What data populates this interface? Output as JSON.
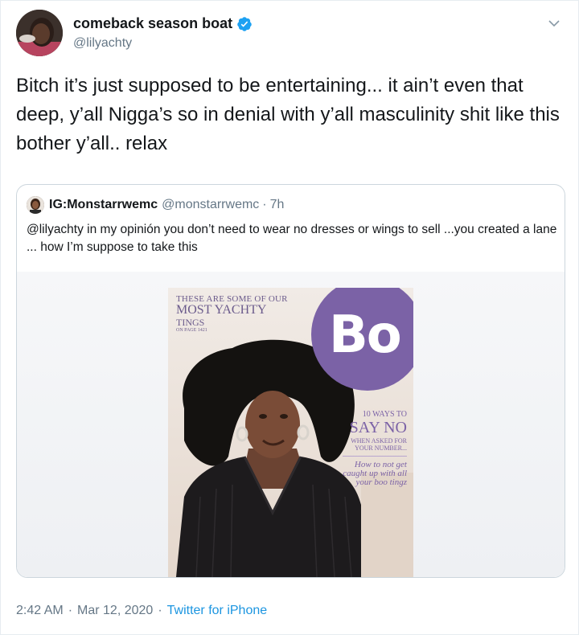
{
  "author": {
    "display_name": "comeback season boat",
    "handle": "@lilyachty",
    "verified": true,
    "avatar_icon": "avatar-photo"
  },
  "tweet": {
    "text": "Bitch it’s just supposed to be entertaining... it ain’t even that deep, y’all Nigga’s so in denial with y’all masculinity shit like this bother y’all.. relax"
  },
  "quoted": {
    "display_name": "IG:Monstarrwemc",
    "handle": "@monstarrwemc",
    "separator": "·",
    "time": "7h",
    "text": "@lilyachty in my opinión you don’t need to wear no dresses or wings to sell ...you created a lane ... how I’m suppose to take this",
    "media": {
      "kicker": "THESE ARE SOME OF OUR",
      "headline": "MOST YACHTY",
      "headline2": "TINGS",
      "page_ref": "ON PAGE 1421",
      "logo": "Bo",
      "side_top": "10 WAYS TO",
      "side_big": "SAY NO",
      "side_small": "WHEN ASKED FOR YOUR NUMBER...",
      "side_italic": "How to not get caught up with all your boo tingz"
    }
  },
  "meta": {
    "time": "2:42 AM",
    "sep1": "·",
    "date": "Mar 12, 2020",
    "sep2": "·",
    "source": "Twitter for iPhone"
  },
  "colors": {
    "link": "#1b95e0",
    "muted": "#657786",
    "verified": "#1da1f2",
    "cover_purple": "#7b62a6"
  }
}
